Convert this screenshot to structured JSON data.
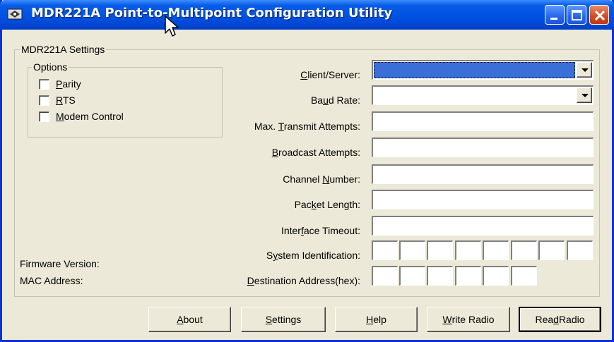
{
  "window": {
    "title": "MDR221A Point-to-Multipoint Configuration Utility",
    "colors": {
      "titlebar": "#0054e3",
      "face": "#ece9d8",
      "selection": "#3a6fd8",
      "close": "#d24a24"
    }
  },
  "settings_group": {
    "label": "MDR221A Settings",
    "options_group": {
      "label": "Options",
      "items": [
        {
          "mnemonic": "P",
          "rest": "arity",
          "checked": false
        },
        {
          "mnemonic": "R",
          "rest": "TS",
          "checked": false
        },
        {
          "mnemonic": "M",
          "rest": "odem Control",
          "checked": false
        }
      ]
    },
    "fields": {
      "client_server": {
        "pre": "",
        "mnemonic": "C",
        "post": "lient/Server:",
        "value": ""
      },
      "baud_rate": {
        "pre": "Ba",
        "mnemonic": "u",
        "post": "d Rate:",
        "value": ""
      },
      "max_transmit": {
        "pre": "Max. ",
        "mnemonic": "T",
        "post": "ransmit Attempts:",
        "value": ""
      },
      "broadcast": {
        "pre": "",
        "mnemonic": "B",
        "post": "roadcast Attempts:",
        "value": ""
      },
      "channel": {
        "pre": "Channel ",
        "mnemonic": "N",
        "post": "umber:",
        "value": ""
      },
      "packet_length": {
        "pre": "Pac",
        "mnemonic": "k",
        "post": "et Length:",
        "value": ""
      },
      "interface_timeout": {
        "pre": "Inter",
        "mnemonic": "f",
        "post": "ace Timeout:",
        "value": ""
      },
      "system_id": {
        "pre": "S",
        "mnemonic": "y",
        "post": "stem Identification:",
        "segments": 8
      },
      "dest_address": {
        "pre": "",
        "mnemonic": "D",
        "post": "estination Address(hex):",
        "segments": 6
      }
    },
    "firmware_label": "Firmware Version:",
    "mac_label": "MAC Address:"
  },
  "buttons": [
    {
      "pre": "",
      "mnemonic": "A",
      "post": "bout"
    },
    {
      "pre": "",
      "mnemonic": "S",
      "post": "ettings"
    },
    {
      "pre": "",
      "mnemonic": "H",
      "post": "elp"
    },
    {
      "pre": "",
      "mnemonic": "W",
      "post": "rite Radio"
    },
    {
      "pre": "Rea",
      "mnemonic": "d",
      "post": " Radio"
    }
  ],
  "icons": {
    "app": "network-app-icon",
    "minimize": "minimize-icon",
    "maximize": "maximize-icon",
    "close": "close-icon",
    "dropdown": "chevron-down-icon",
    "cursor": "mouse-cursor-icon"
  }
}
